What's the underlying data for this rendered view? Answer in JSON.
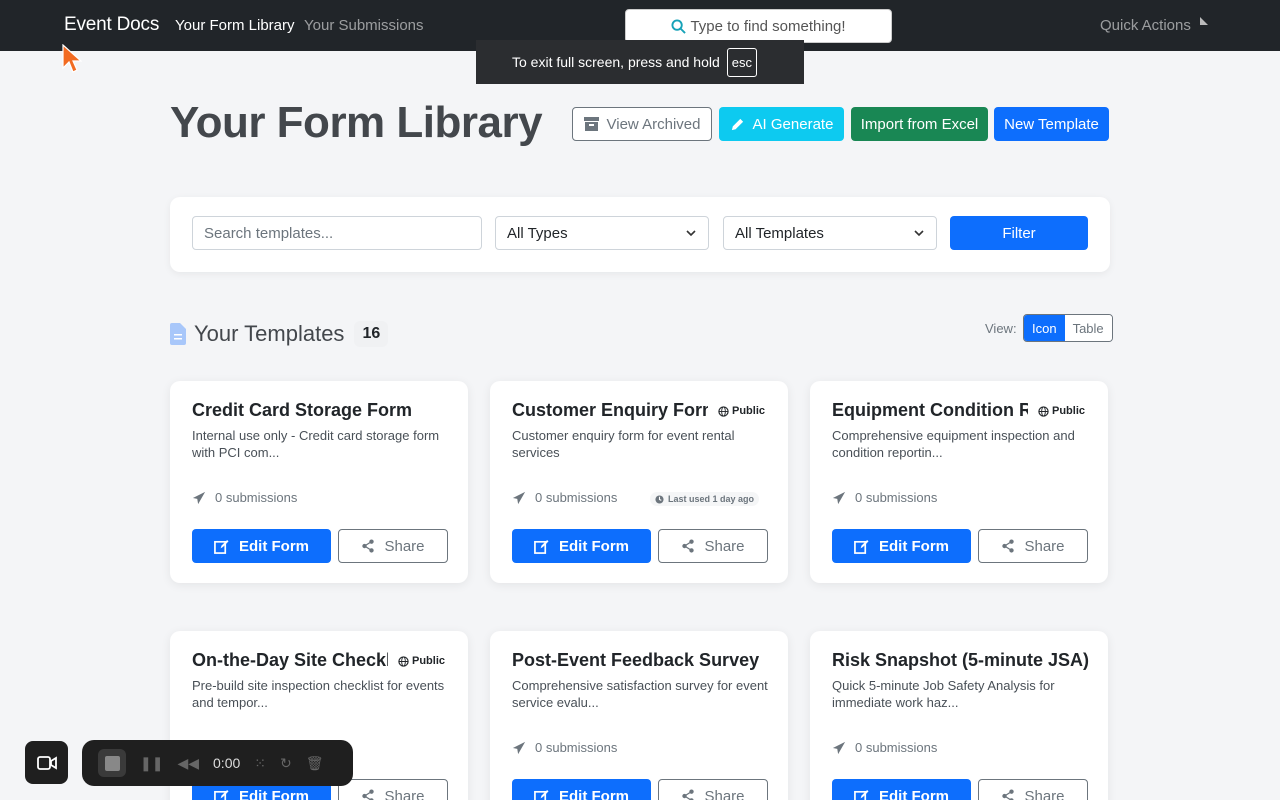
{
  "nav": {
    "brand": "Event Docs",
    "links": [
      "Your Form Library",
      "Your Submissions"
    ],
    "search_placeholder": "Type to find something!",
    "quick_actions": "Quick Actions"
  },
  "fullscreen_notice": {
    "text": "To exit full screen, press and hold",
    "key": "esc"
  },
  "header": {
    "title": "Your Form Library",
    "buttons": {
      "view_archived": "View Archived",
      "ai_generate": "AI Generate",
      "import_excel": "Import from Excel",
      "new_template": "New Template"
    }
  },
  "filters": {
    "search_placeholder": "Search templates...",
    "type_select": "All Types",
    "template_select": "All Templates",
    "filter_button": "Filter"
  },
  "templates_section": {
    "title": "Your Templates",
    "count": "16",
    "view_label": "View:",
    "view_options": [
      "Icon",
      "Table"
    ],
    "active_view": "Icon"
  },
  "cards": [
    {
      "title": "Credit Card Storage Form",
      "public": "",
      "desc": "Internal use only - Credit card storage form with PCI com...",
      "submissions": "0 submissions",
      "last_used": "",
      "edit": "Edit Form",
      "share": "Share"
    },
    {
      "title": "Customer Enquiry Form",
      "public": "Public",
      "desc": "Customer enquiry form for event rental services",
      "submissions": "0 submissions",
      "last_used": "Last used 1 day ago",
      "edit": "Edit Form",
      "share": "Share"
    },
    {
      "title": "Equipment Condition Report",
      "public": "Public",
      "desc": "Comprehensive equipment inspection and condition reportin...",
      "submissions": "0 submissions",
      "last_used": "",
      "edit": "Edit Form",
      "share": "Share"
    },
    {
      "title": "On-the-Day Site Checklist",
      "public": "Public",
      "desc": "Pre-build site inspection checklist for events and tempor...",
      "submissions": "",
      "last_used": "",
      "edit": "Edit Form",
      "share": "Share"
    },
    {
      "title": "Post-Event Feedback Survey",
      "public": "",
      "desc": "Comprehensive satisfaction survey for event service evalu...",
      "submissions": "0 submissions",
      "last_used": "",
      "edit": "Edit Form",
      "share": "Share"
    },
    {
      "title": "Risk Snapshot (5-minute JSA)",
      "public": "",
      "desc": "Quick 5-minute Job Safety Analysis for immediate work haz...",
      "submissions": "0 submissions",
      "last_used": "",
      "edit": "Edit Form",
      "share": "Share"
    }
  ],
  "recorder": {
    "time": "0:00"
  },
  "colors": {
    "primary": "#0d6efd",
    "info": "#0dcaf0",
    "success": "#198754",
    "navbar": "#212529"
  }
}
